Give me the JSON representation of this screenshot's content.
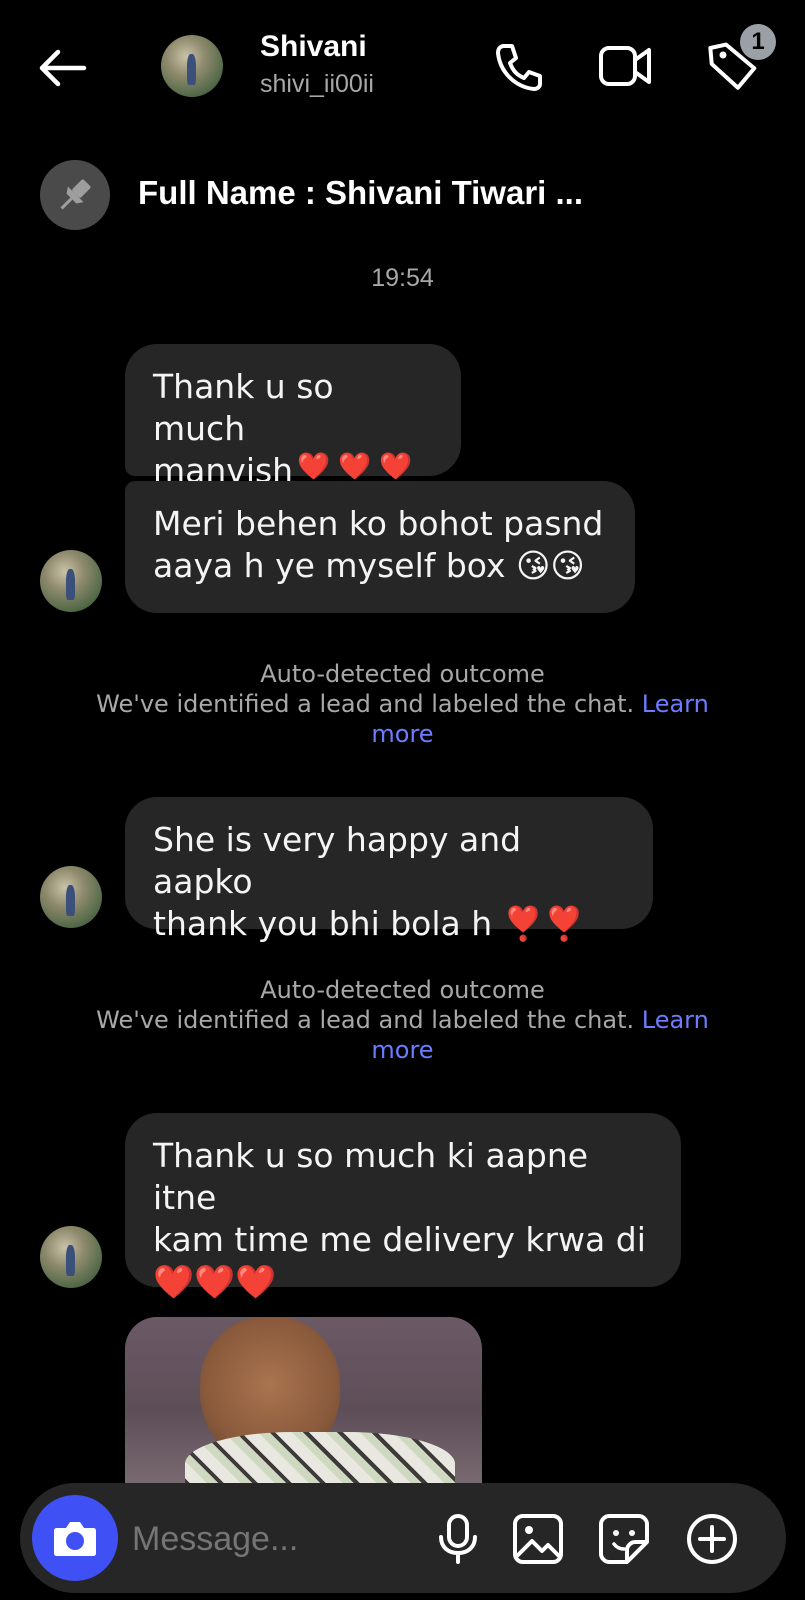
{
  "header": {
    "name": "Shivani",
    "username": "shivi_ii00ii",
    "label_badge_count": "1",
    "icons": [
      "back-arrow-icon",
      "phone-icon",
      "video-icon",
      "label-tag-icon"
    ]
  },
  "pinned": {
    "text": "Full Name : Shivani Tiwari ..."
  },
  "timestamp": "19:54",
  "messages": [
    {
      "text": "Thank u so much\nmanvish❣️❣️❣️"
    },
    {
      "text": "Meri behen ko bohot pasnd\naaya h ye myself box 😘😘"
    },
    {
      "text": "She is very happy and aapko\nthank you bhi bola h ❣️❣️"
    },
    {
      "text": "Thank u so much ki aapne itne\nkam time me delivery krwa di\n❤️❤️❤️"
    }
  ],
  "notices": [
    {
      "title": "Auto-detected outcome",
      "body": "We've identified a lead and labeled the chat.",
      "link": "Learn",
      "link2": "more"
    },
    {
      "title": "Auto-detected outcome",
      "body": "We've identified a lead and labeled the chat.",
      "link": "Learn",
      "link2": "more"
    }
  ],
  "composer": {
    "placeholder": "Message...",
    "icons": [
      "camera-icon",
      "microphone-icon",
      "gallery-icon",
      "sticker-icon",
      "plus-icon"
    ]
  },
  "colors": {
    "background": "#000000",
    "bubble": "#262626",
    "accent": "#3f51f5",
    "link": "#6c7cff",
    "muted": "#a8a8a8"
  }
}
